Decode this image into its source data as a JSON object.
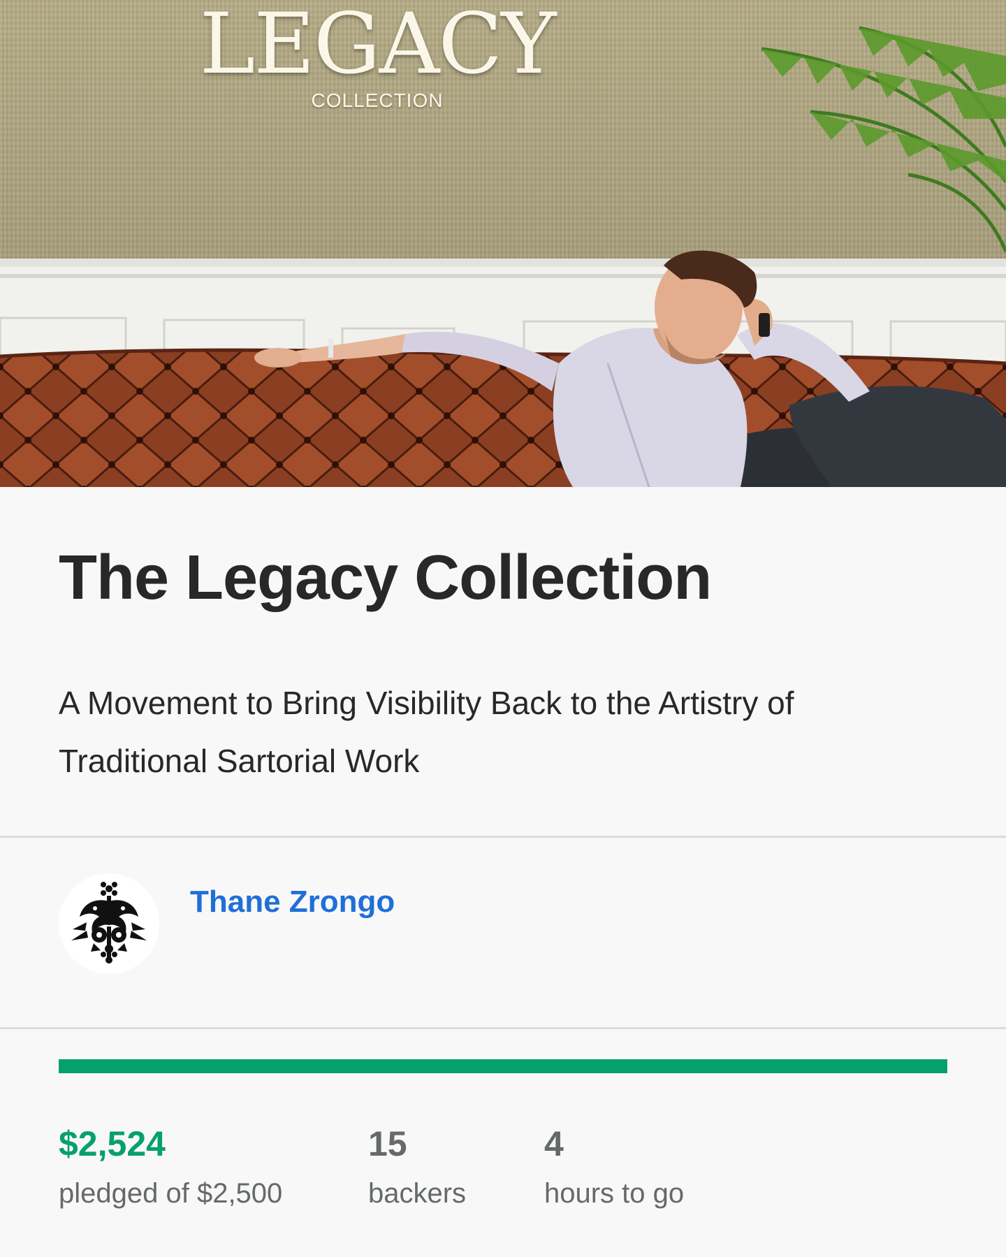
{
  "hero": {
    "logo_word": "LEGACY",
    "logo_sub": "COLLECTION"
  },
  "project": {
    "title": "The Legacy Collection",
    "blurb": "A Movement to Bring Visibility Back to the Artistry of Traditional Sartorial Work"
  },
  "creator": {
    "name": "Thane Zrongo",
    "avatar_icon": "ornamental-bird-emblem-icon"
  },
  "funding": {
    "progress_fraction": 1.0,
    "pledged_amount": "$2,524",
    "pledged_label": "pledged of $2,500",
    "backers_count": "15",
    "backers_label": "backers",
    "time_value": "4",
    "time_label": "hours to go"
  },
  "colors": {
    "accent_green": "#05a06e",
    "creator_link_blue": "#1f6fd8",
    "text_dark": "#282828",
    "text_muted": "#656969"
  }
}
